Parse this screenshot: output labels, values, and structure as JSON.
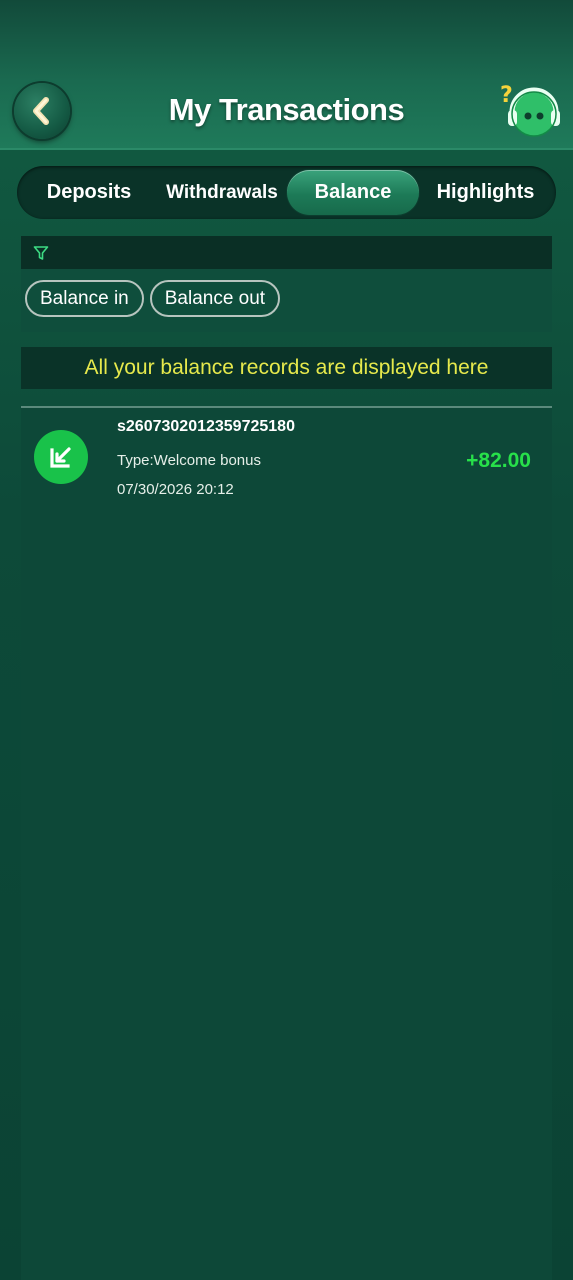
{
  "header": {
    "title": "My Transactions",
    "back_icon": "chevron-left-icon",
    "support_icon": "support-mascot-icon"
  },
  "tabs": [
    {
      "label": "Deposits",
      "active": false
    },
    {
      "label": "Withdrawals",
      "active": false
    },
    {
      "label": "Balance",
      "active": true
    },
    {
      "label": "Highlights",
      "active": false
    }
  ],
  "filters": {
    "icon": "filter-icon",
    "chips": [
      "Balance in",
      "Balance out"
    ]
  },
  "info_banner": "All your balance records are displayed here",
  "records": [
    {
      "icon": "arrow-in-icon",
      "id": "s2607302012359725180",
      "type": "Type:Welcome bonus",
      "time": "07/30/2026 20:12",
      "amount": "+82.00"
    }
  ],
  "colors": {
    "accent_green": "#27e04a",
    "banner_text": "#e6e94c",
    "icon_green": "#19c24a"
  }
}
